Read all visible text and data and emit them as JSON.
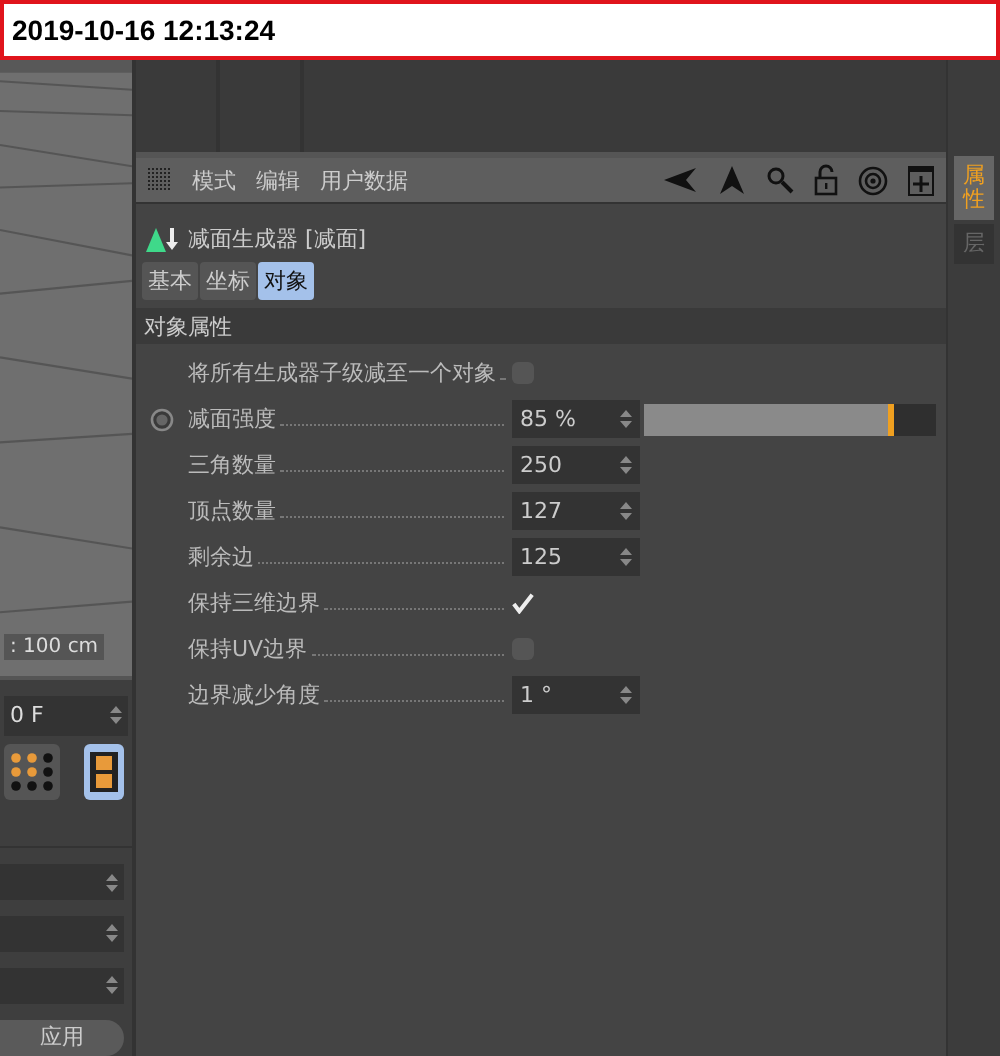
{
  "timestamp": "2019-10-16 12:13:24",
  "left_panel": {
    "viewport_label": ": 100 cm",
    "frame_field": "0 F",
    "tools": [
      {
        "kind": "grid",
        "selected": false
      },
      {
        "kind": "film",
        "selected": true
      }
    ],
    "apply_button": "应用"
  },
  "menu": [
    "模式",
    "编辑",
    "用户数据"
  ],
  "object_title": "减面生成器 [减面]",
  "tabs": [
    {
      "label": "基本",
      "selected": false
    },
    {
      "label": "坐标",
      "selected": false
    },
    {
      "label": "对象",
      "selected": true
    }
  ],
  "section": "对象属性",
  "rows": [
    {
      "kind": "checkbox",
      "label": "将所有生成器子级减至一个对象",
      "checked": false
    },
    {
      "kind": "slider",
      "label": "减面强度",
      "value": "85 %",
      "level": 0.85
    },
    {
      "kind": "number",
      "label": "三角数量",
      "value": "250"
    },
    {
      "kind": "number",
      "label": "顶点数量",
      "value": "127"
    },
    {
      "kind": "number",
      "label": "剩余边",
      "value": "125"
    },
    {
      "kind": "checkbox",
      "label": "保持三维边界",
      "checked": true
    },
    {
      "kind": "checkbox",
      "label": "保持UV边界",
      "checked": false
    },
    {
      "kind": "number",
      "label": "边界减少角度",
      "value": "1 °"
    }
  ],
  "side_tabs": [
    {
      "label": "属性",
      "selected": true
    },
    {
      "label": "层",
      "selected": false
    }
  ]
}
